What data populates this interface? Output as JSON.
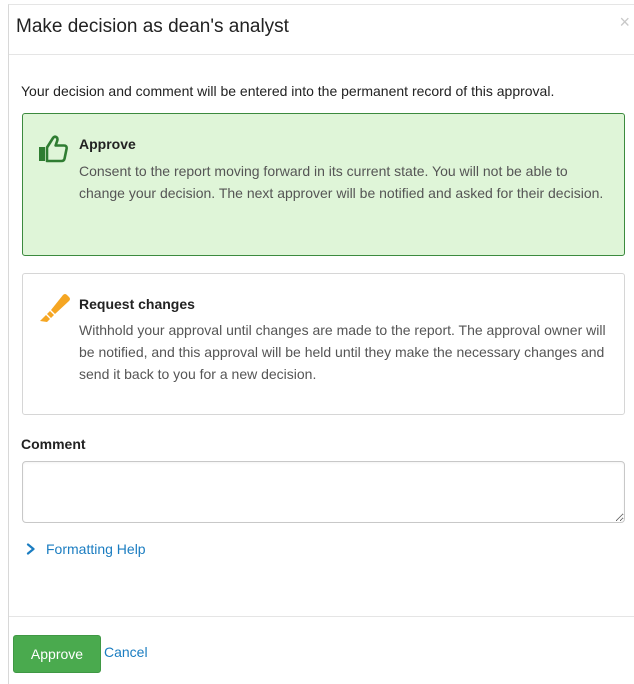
{
  "dialog": {
    "title": "Make decision as dean's analyst",
    "close_label": "×"
  },
  "intro_text": "Your decision and comment will be entered into the permanent record of this approval.",
  "options": [
    {
      "icon": "thumbs-up-icon",
      "title": "Approve",
      "description": "Consent to the report moving forward in its current state. You will not be able to change your decision. The next approver will be notified and asked for their decision.",
      "selected": true
    },
    {
      "icon": "highlighter-icon",
      "title": "Request changes",
      "description": "Withhold your approval until changes are made to the report. The approval owner will be notified, and this approval will be held until they make the necessary changes and send it back to you for a new decision.",
      "selected": false
    }
  ],
  "comment": {
    "label": "Comment",
    "value": ""
  },
  "formatting_help": {
    "label": "Formatting Help"
  },
  "footer": {
    "approve_label": "Approve",
    "cancel_label": "Cancel"
  },
  "colors": {
    "selected_bg": "#dff5d8",
    "selected_border": "#3b8a3e",
    "approve_icon": "#2f7d32",
    "changes_icon": "#f5a623",
    "link": "#1b7dc1",
    "approve_button": "#4aaa4e"
  }
}
